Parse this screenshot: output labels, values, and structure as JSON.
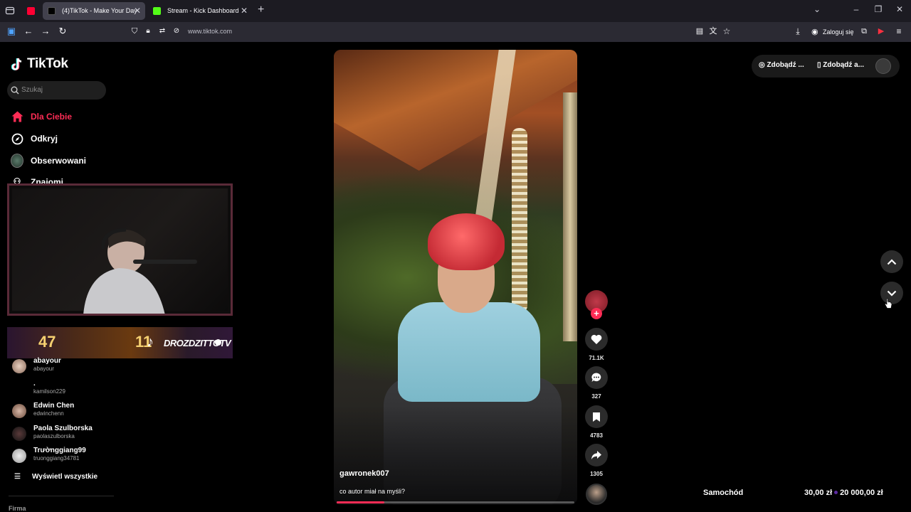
{
  "browser": {
    "tabs": [
      {
        "label": "(4)TikTok - Make Your Day",
        "active": true
      },
      {
        "label": "Stream - Kick Dashboard",
        "active": false
      }
    ],
    "url": "www.tiktok.com",
    "login_label": "Zaloguj się"
  },
  "sidebar": {
    "logo": "TikTok",
    "search_placeholder": "Szukaj",
    "nav": [
      {
        "label": "Dla Ciebie",
        "icon": "home-icon",
        "active": true
      },
      {
        "label": "Odkryj",
        "icon": "compass-icon"
      },
      {
        "label": "Obserwowani",
        "icon": "avatar-icon"
      },
      {
        "label": "Znajomi",
        "icon": "friends-icon"
      }
    ],
    "overlay_banner": {
      "num1": "47",
      "num2": "11",
      "text": "DROZDZITTOTV"
    },
    "accounts": [
      {
        "name": "abayour",
        "handle": "abayour"
      },
      {
        "name": ".",
        "handle": "kamilson229"
      },
      {
        "name": "Edwin Chen",
        "handle": "edwinchenn"
      },
      {
        "name": "Paola Szulborska",
        "handle": "paolaszulborska"
      },
      {
        "name": "Trườnggiang99",
        "handle": "truonggiang34781"
      }
    ],
    "see_all": "Wyświetl wszystkie",
    "footer": "Firma"
  },
  "video": {
    "author": "gawronek007",
    "description": "co autor miał na myśli?",
    "progress": 0.2,
    "likes": "71.1K",
    "comments": "327",
    "saves": "4783",
    "shares": "1305"
  },
  "top_right": {
    "btn1": "Zdobądź ...",
    "btn2": "Zdobądź a..."
  },
  "stream_overlay": {
    "left": "Samochód",
    "amount_current": "30,00 zł",
    "amount_goal": "20 000,00 zł"
  },
  "colors": {
    "accent": "#fe2c55",
    "chrome_bg": "#1c1b22",
    "nav_bg": "#2b2a33"
  }
}
